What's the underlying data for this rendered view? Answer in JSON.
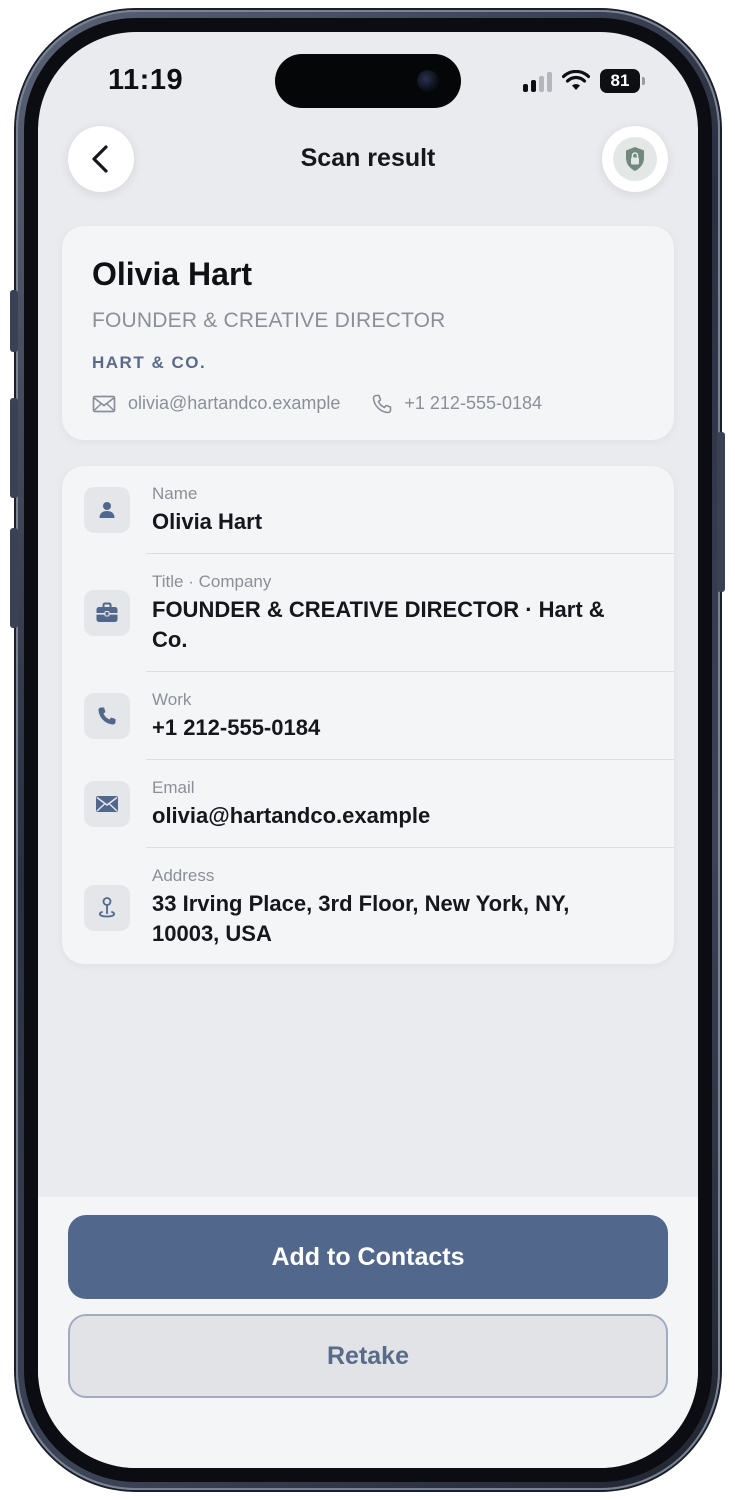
{
  "status_bar": {
    "time": "11:19",
    "battery": "81"
  },
  "header": {
    "title": "Scan result"
  },
  "hero": {
    "name": "Olivia Hart",
    "title": "FOUNDER & CREATIVE DIRECTOR",
    "company": "HART & CO.",
    "email": "olivia@hartandco.example",
    "phone": "+1 212-555-0184"
  },
  "details": [
    {
      "label": "Name",
      "value": "Olivia Hart",
      "icon": "person-icon"
    },
    {
      "label": "Title · Company",
      "value": "FOUNDER & CREATIVE DIRECTOR · Hart & Co.",
      "icon": "briefcase-icon"
    },
    {
      "label": "Work",
      "value": "+1 212-555-0184",
      "icon": "phone-icon"
    },
    {
      "label": "Email",
      "value": "olivia@hartandco.example",
      "icon": "envelope-icon"
    },
    {
      "label": "Address",
      "value": "33 Irving Place, 3rd Floor, New York, NY, 10003, USA",
      "icon": "location-pin-icon"
    }
  ],
  "actions": {
    "primary": "Add to Contacts",
    "secondary": "Retake"
  },
  "colors": {
    "accent": "#52678c",
    "company": "#5a6b8a",
    "background": "#eaebee"
  }
}
